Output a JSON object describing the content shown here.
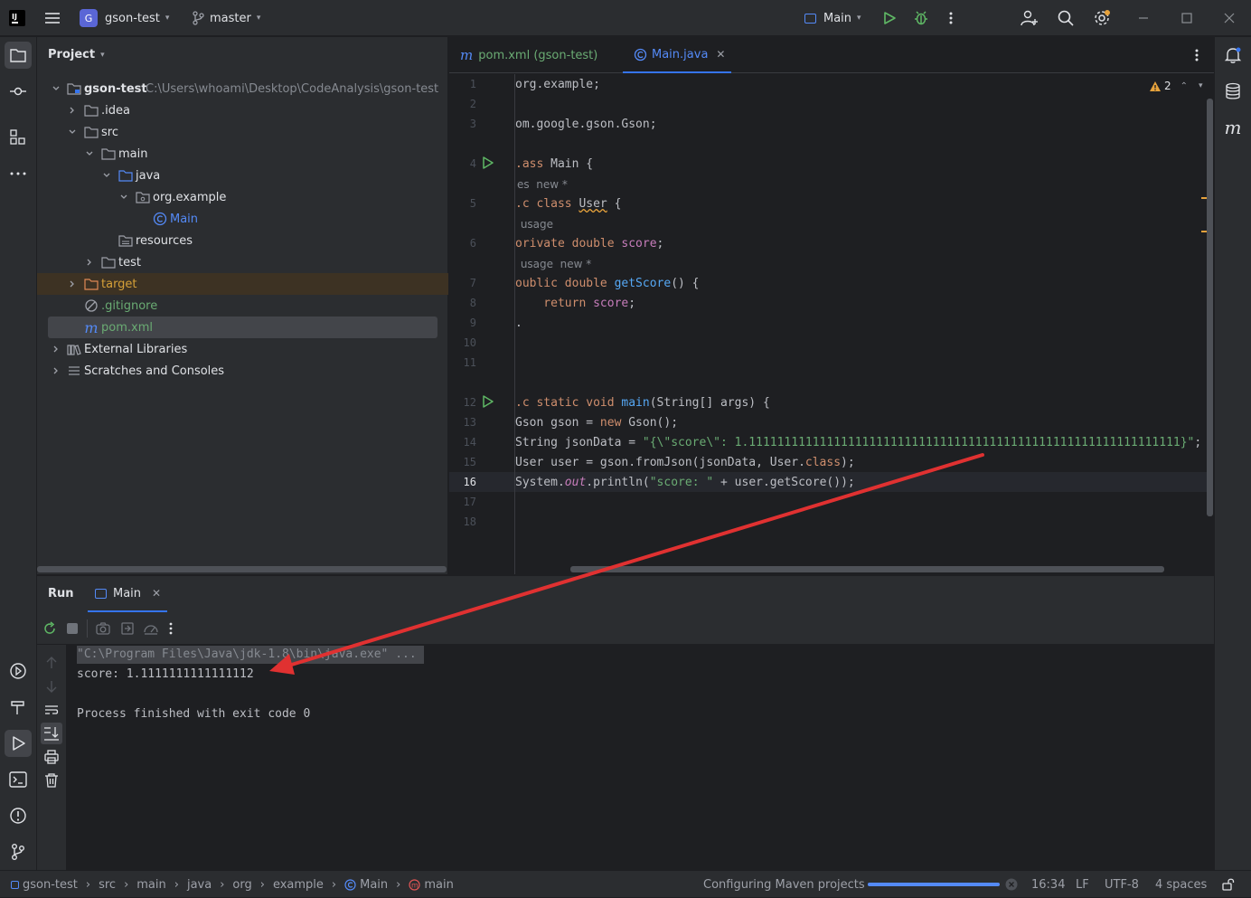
{
  "titlebar": {
    "project_badge": "G",
    "project_name": "gson-test",
    "branch": "master",
    "run_config": "Main"
  },
  "project_panel": {
    "title": "Project",
    "tree": [
      {
        "label": "gson-test",
        "path": "C:\\Users\\whoami\\Desktop\\CodeAnalysis\\gson-test"
      },
      {
        "label": ".idea"
      },
      {
        "label": "src"
      },
      {
        "label": "main"
      },
      {
        "label": "java"
      },
      {
        "label": "org.example"
      },
      {
        "label": "Main"
      },
      {
        "label": "resources"
      },
      {
        "label": "test"
      },
      {
        "label": "target"
      },
      {
        "label": ".gitignore"
      },
      {
        "label": "pom.xml"
      },
      {
        "label": "External Libraries"
      },
      {
        "label": "Scratches and Consoles"
      }
    ]
  },
  "editor": {
    "tabs": [
      {
        "label": "pom.xml (gson-test)"
      },
      {
        "label": "Main.java"
      }
    ],
    "warnings_count": "2",
    "line_numbers": [
      "1",
      "2",
      "3",
      "4",
      "5",
      "6",
      "7",
      "8",
      "9",
      "10",
      "11",
      "12",
      "13",
      "14",
      "15",
      "16",
      "17",
      "18"
    ],
    "hints": [
      "es  new *",
      " usage",
      " usage  new *"
    ],
    "code": {
      "l1": "org.example;",
      "l3": "om.google.gson.Gson;",
      "l4_a": ".ass ",
      "l4_b": "Main {",
      "l5_a": ".c class ",
      "l5_b": "User",
      "l5_c": " {",
      "l6_a": "orivate double ",
      "l6_b": "score",
      "l6_c": ";",
      "l7_a": "oublic double ",
      "l7_b": "getScore",
      "l7_c": "() {",
      "l8_a": "    return ",
      "l8_b": "score",
      "l8_c": ";",
      "l9": ".",
      "l12_a": ".c static void ",
      "l12_b": "main",
      "l12_c": "(String[] args) {",
      "l13_a": "Gson gson = ",
      "l13_b": "new ",
      "l13_c": "Gson();",
      "l14_a": "String jsonData = ",
      "l14_b": "\"{\\\"score\\\": 1.1111111111111111111111111111111111111111111111111111111111111}\"",
      "l14_c": ";",
      "l15_a": "User user = gson.fromJson(jsonData, User.",
      "l15_b": "class",
      "l15_c": ");",
      "l16_a": "System.",
      "l16_b": "out",
      "l16_c": ".println(",
      "l16_d": "\"score: \"",
      "l16_e": " + user.getScore());"
    }
  },
  "run_panel": {
    "tab_run": "Run",
    "tab_main": "Main",
    "console": [
      "\"C:\\Program Files\\Java\\jdk-1.8\\bin\\java.exe\" ...",
      "score: 1.1111111111111112",
      "",
      "Process finished with exit code 0"
    ]
  },
  "statusbar": {
    "breadcrumbs": [
      "gson-test",
      "src",
      "main",
      "java",
      "org",
      "example",
      "Main",
      "main"
    ],
    "task": "Configuring Maven projects",
    "progress": 1.0,
    "time": "16:34",
    "line_sep": "LF",
    "encoding": "UTF-8",
    "indent": "4 spaces"
  },
  "colors": {
    "accent": "#3574f0",
    "run_green": "#5fb865",
    "annotation_arrow": "#e03131"
  }
}
